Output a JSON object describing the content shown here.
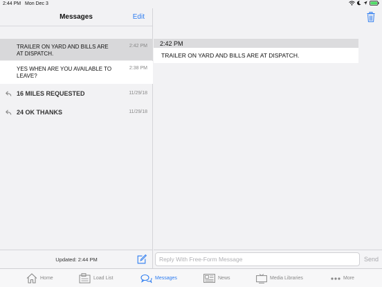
{
  "status_bar": {
    "time": "2:44 PM",
    "date": "Mon Dec 3"
  },
  "left": {
    "title": "Messages",
    "edit_label": "Edit",
    "messages": [
      {
        "text": "TRAILER ON YARD AND BILLS ARE AT DISPATCH.",
        "time": "2:42 PM",
        "selected": true,
        "replied": false
      },
      {
        "text": "YES WHEN ARE YOU AVAILABLE TO LEAVE?",
        "time": "2:38 PM",
        "selected": false,
        "replied": false
      },
      {
        "text": "16 MILES REQUESTED",
        "time": "11/29/18",
        "selected": false,
        "replied": true
      },
      {
        "text": "24 OK THANKS",
        "time": "11/29/18",
        "selected": false,
        "replied": true
      }
    ],
    "updated": "Updated: 2:44 PM"
  },
  "detail": {
    "time": "2:42 PM",
    "body": "TRAILER ON YARD AND BILLS ARE AT DISPATCH."
  },
  "reply": {
    "placeholder": "Reply With Free-Form Message",
    "send_label": "Send"
  },
  "tabs": [
    {
      "label": "Home",
      "icon": "home-icon",
      "active": false
    },
    {
      "label": "Load List",
      "icon": "load-list-icon",
      "active": false
    },
    {
      "label": "Messages",
      "icon": "messages-icon",
      "active": true
    },
    {
      "label": "News",
      "icon": "news-icon",
      "active": false
    },
    {
      "label": "Media Libraries",
      "icon": "media-libraries-icon",
      "active": false
    },
    {
      "label": "More",
      "icon": "more-icon",
      "active": false
    }
  ],
  "colors": {
    "accent": "#2d7cf0",
    "selected_row": "#d8d8da",
    "battery": "#4cd964"
  }
}
